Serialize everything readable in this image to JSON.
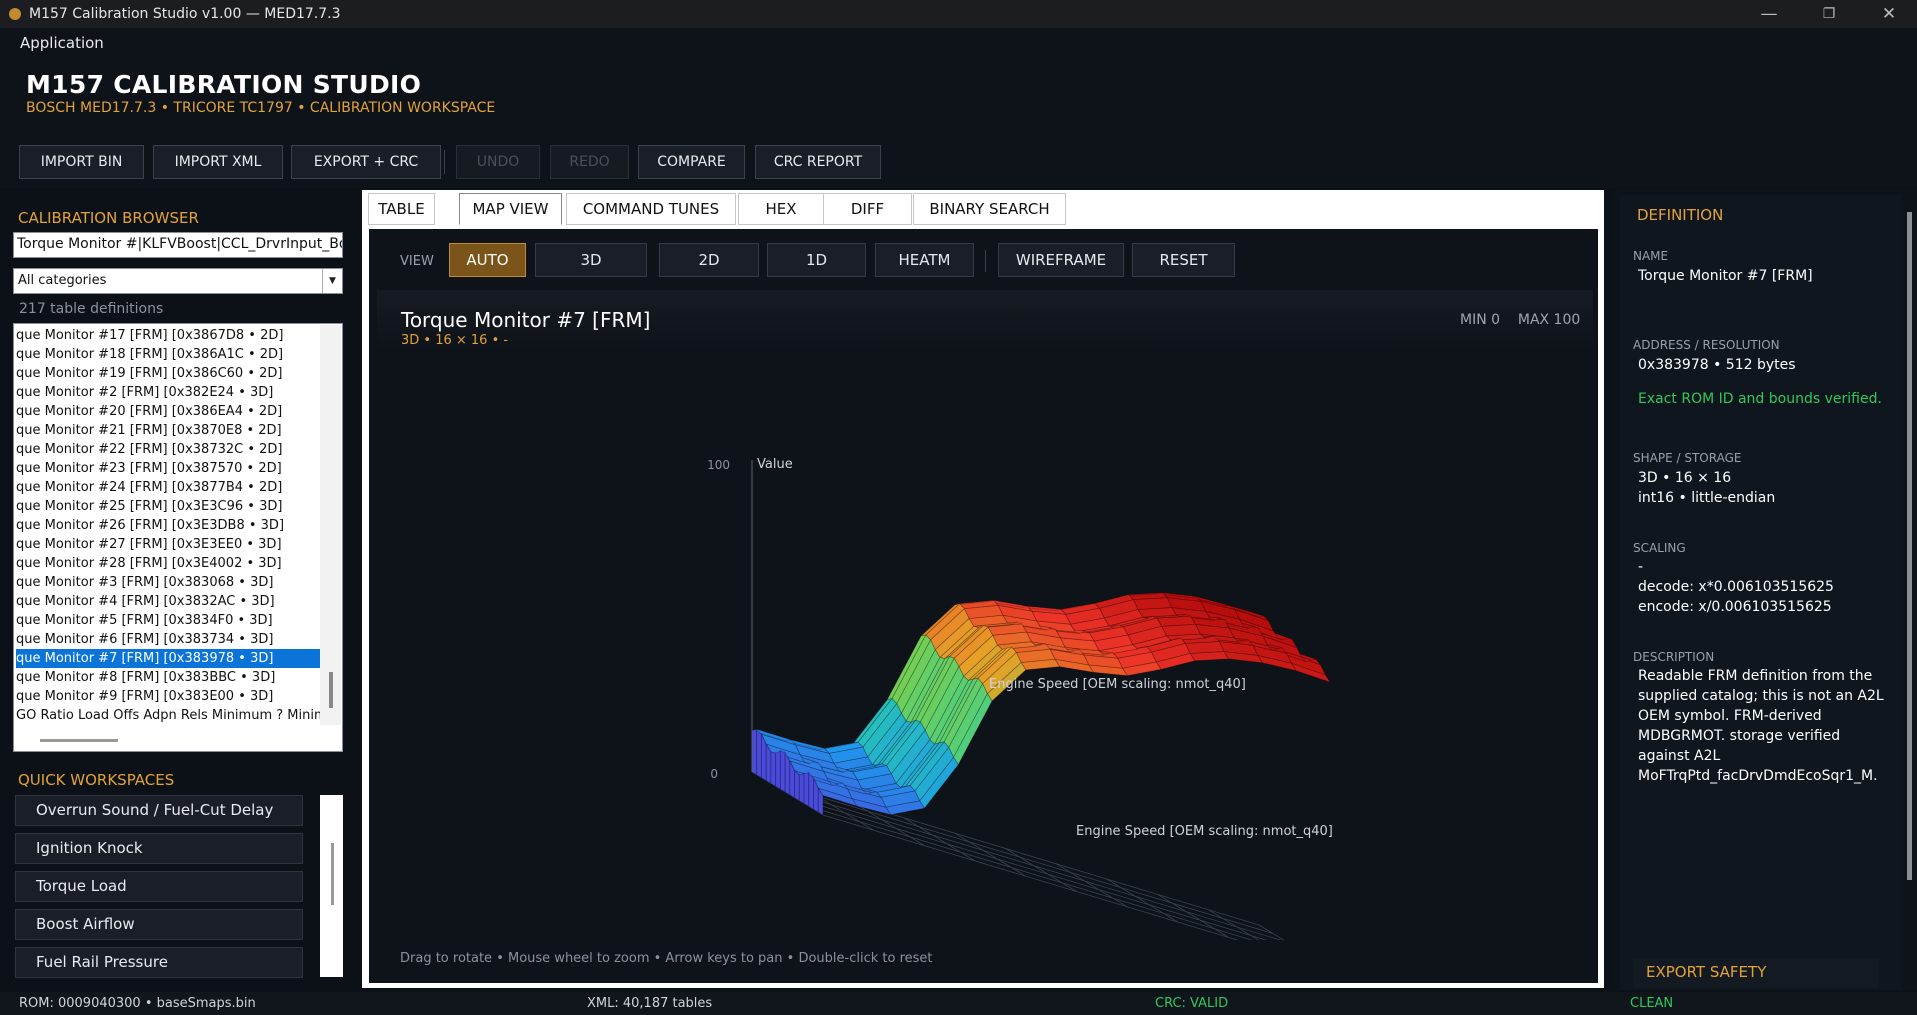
{
  "window": {
    "title": "M157 Calibration Studio v1.00 — MED17.7.3"
  },
  "menu": {
    "application": "Application"
  },
  "header": {
    "title": "M157 CALIBRATION STUDIO",
    "subtitle": "BOSCH MED17.7.3  •  TRICORE TC1797  •  CALIBRATION WORKSPACE"
  },
  "toolbar": {
    "import_bin": "IMPORT BIN",
    "import_xml": "IMPORT XML",
    "export_crc": "EXPORT + CRC",
    "undo": "UNDO",
    "redo": "REDO",
    "compare": "COMPARE",
    "crc_report": "CRC REPORT"
  },
  "browser": {
    "title": "CALIBRATION BROWSER",
    "search_value": "Torque Monitor #|KLFVBoost|CCL_DrvrInput_Boos",
    "category": "All categories",
    "count": "217 table definitions",
    "items": [
      "que Monitor #17 [FRM]   [0x3867D8 • 2D]",
      "que Monitor #18 [FRM]   [0x386A1C • 2D]",
      "que Monitor #19 [FRM]   [0x386C60 • 2D]",
      "que Monitor #2 [FRM]   [0x382E24 • 3D]",
      "que Monitor #20 [FRM]   [0x386EA4 • 2D]",
      "que Monitor #21 [FRM]   [0x3870E8 • 2D]",
      "que Monitor #22 [FRM]   [0x38732C • 2D]",
      "que Monitor #23 [FRM]   [0x387570 • 2D]",
      "que Monitor #24 [FRM]   [0x3877B4 • 2D]",
      "que Monitor #25 [FRM]   [0x3E3C96 • 3D]",
      "que Monitor #26 [FRM]   [0x3E3DB8 • 3D]",
      "que Monitor #27 [FRM]   [0x3E3EE0 • 3D]",
      "que Monitor #28 [FRM]   [0x3E4002 • 3D]",
      "que Monitor #3 [FRM]   [0x383068 • 3D]",
      "que Monitor #4 [FRM]   [0x3832AC • 3D]",
      "que Monitor #5 [FRM]   [0x3834F0 • 3D]",
      "que Monitor #6 [FRM]   [0x383734 • 3D]",
      "que Monitor #7 [FRM]   [0x383978 • 3D]",
      "que Monitor #8 [FRM]   [0x383BBC • 3D]",
      "que Monitor #9 [FRM]   [0x383E00 • 3D]",
      "GO Ratio Load Offs Adpn Rels Minimum ? Minimu"
    ],
    "selected_index": 17
  },
  "quick": {
    "title": "QUICK WORKSPACES",
    "items": [
      "Overrun Sound / Fuel-Cut Delay",
      "Ignition  Knock",
      "Torque  Load",
      "Boost  Airflow",
      "Fuel  Rail Pressure"
    ]
  },
  "tabs": [
    "TABLE",
    "MAP VIEW",
    "COMMAND TUNES",
    "HEX",
    "DIFF",
    "BINARY SEARCH"
  ],
  "active_tab": "MAP VIEW",
  "view": {
    "label": "VIEW",
    "modes": [
      "AUTO",
      "3D",
      "2D",
      "1D",
      "HEATM"
    ],
    "active": "AUTO",
    "wireframe": "WIREFRAME",
    "reset": "RESET"
  },
  "plot": {
    "title": "Torque Monitor #7 [FRM]",
    "subtitle": "3D  •  16 × 16  •  -",
    "min": "MIN 0",
    "max": "MAX 100",
    "z_max_tick": "100",
    "z_min_tick": "0",
    "z_label": "Value",
    "axis_x_label": "Engine Speed [OEM scaling: nmot_q40]",
    "axis_y_label": "Engine Speed [OEM scaling: nmot_q40]",
    "hint": "Drag to rotate  •  Mouse wheel to zoom  •  Arrow keys to pan  •  Double-click to reset"
  },
  "definition": {
    "title": "DEFINITION",
    "name_label": "NAME",
    "name": "Torque Monitor #7 [FRM]",
    "addr_label": "ADDRESS / RESOLUTION",
    "addr": "0x383978  •  512 bytes",
    "verified": "Exact ROM ID and bounds verified.",
    "shape_label": "SHAPE / STORAGE",
    "shape1": "3D  •  16 × 16",
    "shape2": "int16  •  little-endian",
    "scaling_label": "SCALING",
    "scaling_unit": "-",
    "decode": "decode: x*0.006103515625",
    "encode": "encode: x/0.006103515625",
    "desc_label": "DESCRIPTION",
    "desc": [
      "Readable FRM definition from the",
      "supplied catalog; this is not an A2L",
      "OEM symbol. FRM-derived",
      "MDBGRMOT. storage verified",
      "against A2L",
      "MoFTrqPtd_facDrvDmdEcoSqr1_M."
    ],
    "export_safety": "EXPORT SAFETY"
  },
  "status": {
    "rom": "ROM: 0009040300  •  baseSmaps.bin",
    "xml": "XML: 40,187 tables",
    "crc": "CRC: VALID",
    "state": "CLEAN"
  },
  "colors": {
    "accent": "#e2a23b",
    "ok": "#34c759",
    "selection": "#0a74d8"
  }
}
